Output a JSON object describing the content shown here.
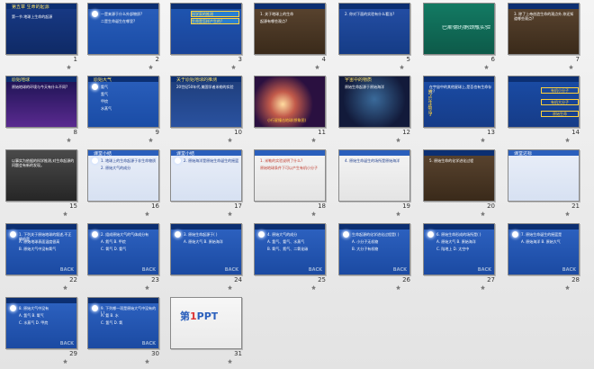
{
  "slides": [
    {
      "num": "1",
      "title": "第五章 生命的起源",
      "sub": "第一节 地球上生命的起源"
    },
    {
      "num": "2",
      "lines": [
        "一是来源于什么外部物质?",
        "二是生命诞生在哪里?"
      ]
    },
    {
      "num": "3",
      "box": [
        "科学家的推测",
        "生命是怎样产生的?"
      ]
    },
    {
      "num": "4",
      "lines": [
        "1. 关于地球上的生命",
        "起源有哪些观点?"
      ]
    },
    {
      "num": "5",
      "lines": [
        "2. 你对下面的实验有什么看法?"
      ]
    },
    {
      "num": "6",
      "title": "巴斯德的鹅颈瓶实验"
    },
    {
      "num": "7",
      "lines": [
        "3. 除了上帝创造生命的观点外,你还知道哪些观点?"
      ]
    },
    {
      "num": "8",
      "title": "原始地球",
      "lines": [
        "原始地球的环境与今天有什么不同?"
      ]
    },
    {
      "num": "9",
      "title": "原始大气",
      "lines": [
        "氨气",
        "氢气",
        "甲烷",
        "水蒸气"
      ]
    },
    {
      "num": "10",
      "title": "关于原始地球的推测",
      "lines": [
        "20世纪50年代,美国学者米勒的实验"
      ]
    },
    {
      "num": "11",
      "caption": "小行星撞击地球(想象图)"
    },
    {
      "num": "12",
      "title": "宇宙中的物质",
      "lines": [
        "原始生命起源于原始海洋"
      ]
    },
    {
      "num": "13",
      "vertical": "热点生物学",
      "lines": [
        "在宇宙中的其他星球上,是否也有生命存在?"
      ]
    },
    {
      "num": "14",
      "labels": [
        "有机小分子",
        "有机大分子",
        "原始生命"
      ]
    },
    {
      "num": "15",
      "lines": [
        "以事实为依据的科学推测,对生命起源的问题会有新的发现。"
      ]
    },
    {
      "num": "16",
      "title": "课堂小结",
      "lines": [
        "1. 地球上的生命起源于非生命物质",
        "2. 原始大气的成分"
      ]
    },
    {
      "num": "17",
      "title": "课堂小结",
      "lines": [
        "2. 原始海洋是原始生命诞生的摇篮"
      ]
    },
    {
      "num": "18",
      "lines": [
        "1. 米勒的实验说明了什么?",
        "原始地球条件下可以产生有机小分子"
      ]
    },
    {
      "num": "19",
      "lines": [
        "4. 原始生命诞生的场所是原始海洋"
      ]
    },
    {
      "num": "20",
      "lines": [
        "5. 原始生命的化学进化过程"
      ]
    },
    {
      "num": "21",
      "title": "课堂达标"
    },
    {
      "num": "22",
      "lines": [
        "1. 下列关于原始地球的叙述,不正确的是",
        "A. 原始地球表面温度很高",
        "B. 原始大气中没有氧气"
      ],
      "back": "BACK"
    },
    {
      "num": "23",
      "lines": [
        "2. 组成原始大气的气体成分有",
        "A. 氮气 B. 甲烷",
        "C. 氧气 D. 氨气"
      ],
      "back": "BACK"
    },
    {
      "num": "24",
      "lines": [
        "3. 原始生命起源于( )",
        "A. 原始大气 B. 原始海洋"
      ],
      "back": "BACK"
    },
    {
      "num": "25",
      "lines": [
        "4. 原始大气的成分",
        "A. 氢气、氨气、水蒸气",
        "B. 氧气、氮气、二氧化碳"
      ],
      "back": "BACK"
    },
    {
      "num": "26",
      "lines": [
        "生命起源的化学进化过程是( )",
        "A. 小分子无机物",
        "B. 大分子有机物"
      ],
      "back": "BACK"
    },
    {
      "num": "27",
      "lines": [
        "6. 原始生命形成的场所是( )",
        "A. 原始大气 B. 原始海洋",
        "C. 陆地上 D. 太空中"
      ],
      "back": "BACK"
    },
    {
      "num": "28",
      "lines": [
        "7. 原始生命诞生的摇篮是",
        "A. 原始海洋 B. 原始大气"
      ],
      "back": "BACK"
    },
    {
      "num": "29",
      "lines": [
        "8. 原始大气中没有",
        "A. 氢气 B. 氧气",
        "C. 水蒸气 D. 甲烷"
      ],
      "back": "BACK"
    },
    {
      "num": "30",
      "lines": [
        "9. 下列哪一项是原始大气中没有的( )",
        "A. 氨 B. 水",
        "C. 氢气 D. 氧"
      ],
      "back": "BACK"
    },
    {
      "num": "31",
      "logo": "第1PPT"
    }
  ]
}
